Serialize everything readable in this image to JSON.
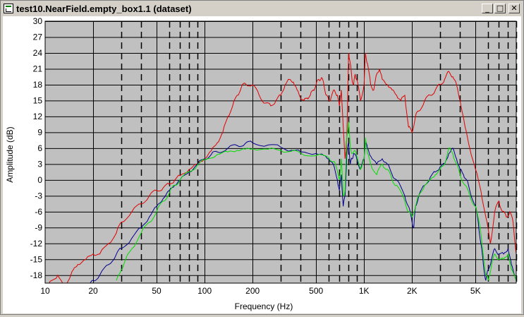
{
  "window": {
    "title": "test10.NearField.empty_box1.1 (dataset)",
    "buttons": {
      "minimize": "_",
      "maximize": "□",
      "close": "✕"
    }
  },
  "chart_data": {
    "type": "line",
    "xscale": "log",
    "xlim": [
      10,
      9000
    ],
    "ylim": [
      -19.5,
      30
    ],
    "xlabel": "Frequency (Hz)",
    "ylabel": "Amplitude (dB)",
    "xticks": [
      {
        "v": 10,
        "label": "10"
      },
      {
        "v": 20,
        "label": "20"
      },
      {
        "v": 50,
        "label": "50"
      },
      {
        "v": 100,
        "label": "100"
      },
      {
        "v": 200,
        "label": "200"
      },
      {
        "v": 500,
        "label": "500"
      },
      {
        "v": 1000,
        "label": "1K"
      },
      {
        "v": 2000,
        "label": "2K"
      },
      {
        "v": 5000,
        "label": "5K"
      }
    ],
    "yticks": [
      30,
      27,
      24,
      21,
      18,
      15,
      12,
      9,
      6,
      3,
      0,
      -3,
      -6,
      -9,
      -12,
      -15,
      -18
    ],
    "solid_gridlines_x": [
      20,
      50,
      100,
      200,
      500,
      1000,
      2000,
      5000
    ],
    "dashed_gridlines_x": [
      30,
      40,
      60,
      70,
      80,
      90,
      300,
      400,
      600,
      700,
      800,
      900,
      3000,
      4000,
      6000,
      7000,
      8000,
      9000
    ],
    "grid": true,
    "colors": {
      "plot_bg": "#c0c0c0",
      "grid": "#000000"
    },
    "series": [
      {
        "color": "#e00000",
        "points": [
          [
            10,
            -21
          ],
          [
            11,
            -19
          ],
          [
            12,
            -18
          ],
          [
            13,
            -20
          ],
          [
            14,
            -19
          ],
          [
            15,
            -17
          ],
          [
            16,
            -16
          ],
          [
            18,
            -15
          ],
          [
            20,
            -14
          ],
          [
            22,
            -14
          ],
          [
            25,
            -12
          ],
          [
            28,
            -10
          ],
          [
            30,
            -8
          ],
          [
            35,
            -6
          ],
          [
            40,
            -4.5
          ],
          [
            45,
            -3
          ],
          [
            50,
            -2
          ],
          [
            55,
            -1.5
          ],
          [
            60,
            -0.8
          ],
          [
            65,
            0
          ],
          [
            70,
            0.8
          ],
          [
            80,
            2
          ],
          [
            90,
            3
          ],
          [
            100,
            4
          ],
          [
            110,
            5.5
          ],
          [
            120,
            7
          ],
          [
            130,
            9
          ],
          [
            140,
            12
          ],
          [
            150,
            14
          ],
          [
            160,
            16
          ],
          [
            170,
            17.5
          ],
          [
            180,
            18.2
          ],
          [
            200,
            18
          ],
          [
            220,
            16
          ],
          [
            240,
            14.5
          ],
          [
            260,
            14
          ],
          [
            280,
            15
          ],
          [
            300,
            16
          ],
          [
            320,
            18
          ],
          [
            340,
            19
          ],
          [
            360,
            18.5
          ],
          [
            380,
            17
          ],
          [
            400,
            15.5
          ],
          [
            420,
            15
          ],
          [
            440,
            15.5
          ],
          [
            460,
            16
          ],
          [
            480,
            17
          ],
          [
            500,
            18
          ],
          [
            520,
            19
          ],
          [
            540,
            19.3
          ],
          [
            560,
            18
          ],
          [
            580,
            16
          ],
          [
            600,
            15
          ],
          [
            620,
            15.5
          ],
          [
            650,
            17
          ],
          [
            680,
            16
          ],
          [
            700,
            14
          ],
          [
            720,
            17
          ],
          [
            740,
            10
          ],
          [
            760,
            4
          ],
          [
            780,
            8
          ],
          [
            800,
            24
          ],
          [
            820,
            22
          ],
          [
            840,
            19
          ],
          [
            860,
            18
          ],
          [
            880,
            20
          ],
          [
            900,
            19
          ],
          [
            950,
            15
          ],
          [
            1000,
            18
          ],
          [
            1020,
            24
          ],
          [
            1050,
            22
          ],
          [
            1100,
            18
          ],
          [
            1150,
            17
          ],
          [
            1200,
            20
          ],
          [
            1250,
            21
          ],
          [
            1300,
            19
          ],
          [
            1400,
            18
          ],
          [
            1500,
            17
          ],
          [
            1600,
            16
          ],
          [
            1700,
            15
          ],
          [
            1800,
            16
          ],
          [
            1900,
            10
          ],
          [
            2000,
            9
          ],
          [
            2100,
            12
          ],
          [
            2200,
            13
          ],
          [
            2400,
            15
          ],
          [
            2600,
            16
          ],
          [
            2800,
            17
          ],
          [
            3000,
            18
          ],
          [
            3200,
            19
          ],
          [
            3400,
            20.5
          ],
          [
            3600,
            19.5
          ],
          [
            3800,
            18
          ],
          [
            4000,
            15
          ],
          [
            4300,
            10
          ],
          [
            4600,
            6
          ],
          [
            5000,
            2
          ],
          [
            5400,
            -2
          ],
          [
            5800,
            -7
          ],
          [
            6200,
            -12
          ],
          [
            6600,
            -6
          ],
          [
            7000,
            -4
          ],
          [
            7400,
            -6
          ],
          [
            7800,
            -7
          ],
          [
            8200,
            -6
          ],
          [
            8600,
            -8
          ],
          [
            9000,
            -14
          ]
        ]
      },
      {
        "color": "#00008b",
        "points": [
          [
            19,
            -20
          ],
          [
            20,
            -19
          ],
          [
            22,
            -18
          ],
          [
            25,
            -16
          ],
          [
            28,
            -14
          ],
          [
            30,
            -13
          ],
          [
            35,
            -11
          ],
          [
            40,
            -9
          ],
          [
            45,
            -7
          ],
          [
            50,
            -5
          ],
          [
            55,
            -3.5
          ],
          [
            60,
            -2
          ],
          [
            65,
            -1
          ],
          [
            70,
            0
          ],
          [
            80,
            1.5
          ],
          [
            90,
            3
          ],
          [
            100,
            4
          ],
          [
            110,
            4.8
          ],
          [
            120,
            5.3
          ],
          [
            140,
            6
          ],
          [
            160,
            6.5
          ],
          [
            180,
            6.9
          ],
          [
            200,
            7
          ],
          [
            250,
            6.6
          ],
          [
            300,
            6.2
          ],
          [
            350,
            5.6
          ],
          [
            400,
            5.3
          ],
          [
            500,
            5
          ],
          [
            560,
            4.6
          ],
          [
            600,
            4
          ],
          [
            640,
            3
          ],
          [
            680,
            0
          ],
          [
            700,
            -2
          ],
          [
            720,
            1
          ],
          [
            740,
            -5
          ],
          [
            760,
            -3
          ],
          [
            780,
            5
          ],
          [
            800,
            7
          ],
          [
            820,
            3
          ],
          [
            840,
            4
          ],
          [
            860,
            5
          ],
          [
            900,
            4
          ],
          [
            950,
            2
          ],
          [
            1000,
            4
          ],
          [
            1020,
            7.5
          ],
          [
            1050,
            6
          ],
          [
            1100,
            4.5
          ],
          [
            1200,
            3
          ],
          [
            1300,
            4
          ],
          [
            1400,
            3
          ],
          [
            1500,
            1
          ],
          [
            1600,
            0
          ],
          [
            1800,
            -3
          ],
          [
            1900,
            -5
          ],
          [
            2000,
            -8
          ],
          [
            2050,
            -9
          ],
          [
            2100,
            -5
          ],
          [
            2200,
            -3
          ],
          [
            2400,
            -1
          ],
          [
            2600,
            0.5
          ],
          [
            2800,
            1.5
          ],
          [
            3000,
            2.5
          ],
          [
            3200,
            3
          ],
          [
            3400,
            5
          ],
          [
            3600,
            6
          ],
          [
            3800,
            4
          ],
          [
            4000,
            2
          ],
          [
            4200,
            1
          ],
          [
            4400,
            0
          ],
          [
            4600,
            -2
          ],
          [
            5000,
            -5
          ],
          [
            5200,
            -8
          ],
          [
            5400,
            -12
          ],
          [
            5600,
            -16
          ],
          [
            5800,
            -19
          ],
          [
            6000,
            -17
          ],
          [
            6300,
            -15
          ],
          [
            6600,
            -13
          ],
          [
            7000,
            -14
          ],
          [
            7500,
            -14
          ],
          [
            8000,
            -13
          ],
          [
            8400,
            -16
          ],
          [
            8800,
            -18
          ],
          [
            9000,
            -19
          ]
        ]
      },
      {
        "color": "#00e000",
        "points": [
          [
            28,
            -19
          ],
          [
            30,
            -17
          ],
          [
            32,
            -15
          ],
          [
            35,
            -13
          ],
          [
            40,
            -10
          ],
          [
            45,
            -8
          ],
          [
            50,
            -6
          ],
          [
            55,
            -4
          ],
          [
            60,
            -2.5
          ],
          [
            65,
            -1
          ],
          [
            70,
            0
          ],
          [
            80,
            1.5
          ],
          [
            90,
            2.8
          ],
          [
            100,
            3.8
          ],
          [
            120,
            4.8
          ],
          [
            140,
            5.3
          ],
          [
            160,
            5.6
          ],
          [
            180,
            5.8
          ],
          [
            200,
            5.9
          ],
          [
            250,
            5.8
          ],
          [
            300,
            5.6
          ],
          [
            350,
            5.4
          ],
          [
            400,
            5.1
          ],
          [
            500,
            4.6
          ],
          [
            600,
            4.2
          ],
          [
            650,
            3.5
          ],
          [
            700,
            0
          ],
          [
            720,
            4
          ],
          [
            740,
            -3
          ],
          [
            760,
            -2
          ],
          [
            780,
            8
          ],
          [
            800,
            11
          ],
          [
            820,
            6
          ],
          [
            840,
            5
          ],
          [
            880,
            5.5
          ],
          [
            950,
            2
          ],
          [
            1000,
            4
          ],
          [
            1020,
            8
          ],
          [
            1050,
            5
          ],
          [
            1100,
            3
          ],
          [
            1200,
            1
          ],
          [
            1300,
            3
          ],
          [
            1400,
            2
          ],
          [
            1500,
            0
          ],
          [
            1600,
            -1
          ],
          [
            1800,
            -4
          ],
          [
            1900,
            -6
          ],
          [
            2000,
            -7
          ],
          [
            2100,
            -5
          ],
          [
            2200,
            -3
          ],
          [
            2400,
            -1
          ],
          [
            2600,
            0
          ],
          [
            2800,
            1
          ],
          [
            3000,
            2
          ],
          [
            3200,
            3
          ],
          [
            3400,
            6
          ],
          [
            3600,
            5
          ],
          [
            3800,
            3
          ],
          [
            4000,
            1
          ],
          [
            4300,
            -1
          ],
          [
            4600,
            -3
          ],
          [
            5000,
            -5
          ],
          [
            5400,
            -10
          ],
          [
            5800,
            -18
          ],
          [
            6000,
            -19
          ],
          [
            6300,
            -16
          ],
          [
            6600,
            -14
          ],
          [
            7000,
            -15
          ],
          [
            7500,
            -15
          ],
          [
            8000,
            -14
          ],
          [
            8400,
            -17
          ],
          [
            8800,
            -18
          ],
          [
            9000,
            -19
          ]
        ]
      }
    ]
  }
}
